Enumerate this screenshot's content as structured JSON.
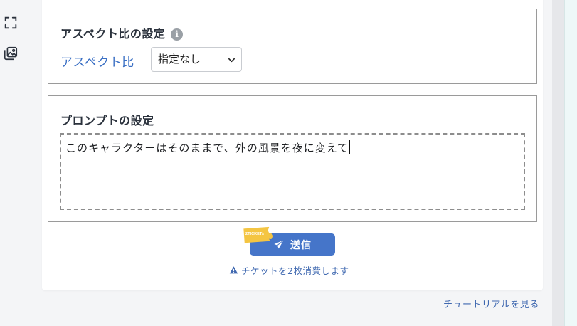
{
  "rail": {
    "icons": [
      "fullscreen-corners-icon",
      "image-gallery-icon"
    ]
  },
  "aspect_section": {
    "title": "アスペクト比の設定",
    "info_glyph": "i",
    "label": "アスペクト比",
    "select_value": "指定なし"
  },
  "prompt_section": {
    "title": "プロンプトの設定",
    "text": "このキャラクターはそのままで、外の風景を夜に変えて"
  },
  "send": {
    "label": "送信",
    "ticket_badge_text": "2TICKETs",
    "consume_text": "チケットを2枚消費します"
  },
  "tutorial_link": "チュートリアルを見る",
  "colors": {
    "accent": "#4575c9",
    "link": "#3f68b0",
    "ticket_yellow": "#f4c542"
  }
}
